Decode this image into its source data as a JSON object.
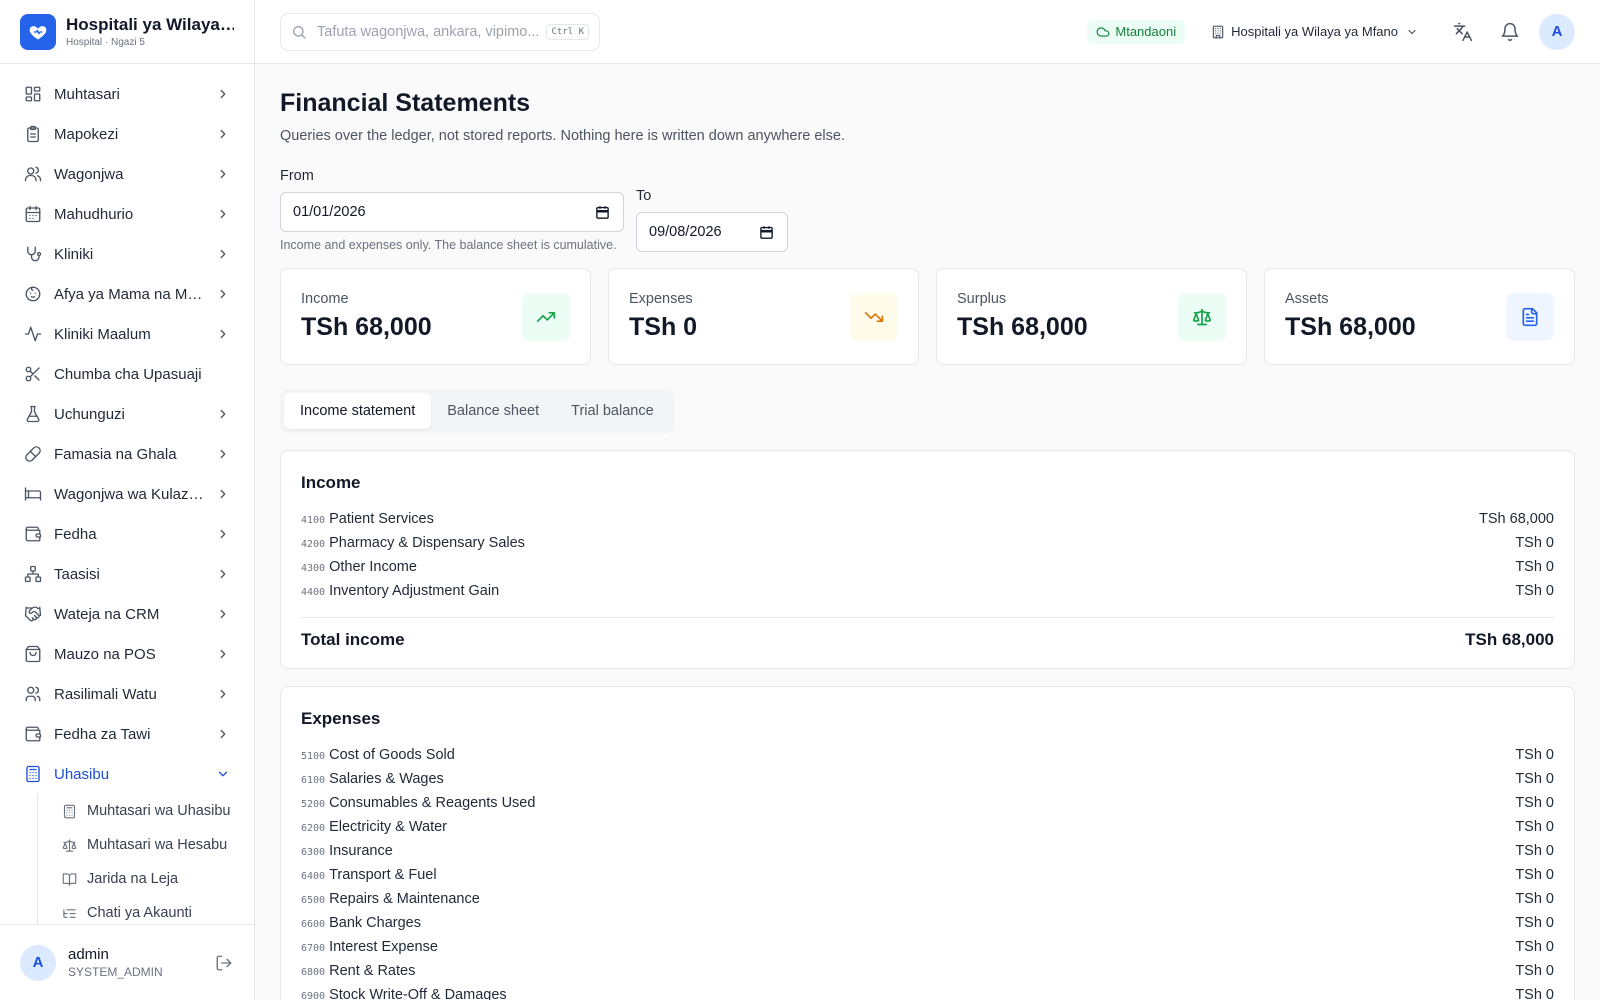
{
  "brand": {
    "name": "Hospitali ya Wilaya ...",
    "subtitle": "Hospital · Ngazi 5"
  },
  "search": {
    "placeholder": "Tafuta wagonjwa, ankara, vipimo...",
    "shortcut": "Ctrl K"
  },
  "topbar": {
    "status": "Mtandaoni",
    "branch": "Hospitali ya Wilaya ya Mfano",
    "avatar": "A"
  },
  "sidebar": {
    "items": [
      {
        "label": "Muhtasari",
        "icon": "dashboard-icon",
        "chevron": "right"
      },
      {
        "label": "Mapokezi",
        "icon": "clipboard-icon",
        "chevron": "right"
      },
      {
        "label": "Wagonjwa",
        "icon": "users-icon",
        "chevron": "right"
      },
      {
        "label": "Mahudhurio",
        "icon": "calendar-icon",
        "chevron": "right"
      },
      {
        "label": "Kliniki",
        "icon": "stethoscope-icon",
        "chevron": "right"
      },
      {
        "label": "Afya ya Mama na Mtoto",
        "icon": "baby-icon",
        "chevron": "right"
      },
      {
        "label": "Kliniki Maalum",
        "icon": "activity-icon",
        "chevron": "right"
      },
      {
        "label": "Chumba cha Upasuaji",
        "icon": "scissors-icon",
        "chevron": "none"
      },
      {
        "label": "Uchunguzi",
        "icon": "flask-icon",
        "chevron": "right"
      },
      {
        "label": "Famasia na Ghala",
        "icon": "pill-icon",
        "chevron": "right"
      },
      {
        "label": "Wagonjwa wa Kulazwa",
        "icon": "bed-icon",
        "chevron": "right"
      },
      {
        "label": "Fedha",
        "icon": "wallet-icon",
        "chevron": "right"
      },
      {
        "label": "Taasisi",
        "icon": "network-icon",
        "chevron": "right"
      },
      {
        "label": "Wateja na CRM",
        "icon": "handshake-icon",
        "chevron": "right"
      },
      {
        "label": "Mauzo na POS",
        "icon": "shopping-bag-icon",
        "chevron": "right"
      },
      {
        "label": "Rasilimali Watu",
        "icon": "user-group-icon",
        "chevron": "right"
      },
      {
        "label": "Fedha za Tawi",
        "icon": "wallet-icon",
        "chevron": "right"
      },
      {
        "label": "Uhasibu",
        "icon": "calculator-icon",
        "chevron": "down"
      }
    ],
    "sub_items": [
      {
        "label": "Muhtasari wa Uhasibu",
        "icon": "calculator-icon"
      },
      {
        "label": "Muhtasari wa Hesabu",
        "icon": "scale-icon"
      },
      {
        "label": "Jarida na Leja",
        "icon": "book-icon"
      },
      {
        "label": "Chati ya Akaunti",
        "icon": "list-tree-icon"
      }
    ],
    "user": {
      "initial": "A",
      "name": "admin",
      "role": "SYSTEM_ADMIN"
    }
  },
  "page": {
    "title": "Financial Statements",
    "description": "Queries over the ledger, not stored reports. Nothing here is written down anywhere else.",
    "from_label": "From",
    "from_value": "01/01/2026",
    "hint": "Income and expenses only. The balance sheet is cumulative.",
    "to_label": "To",
    "to_value": "09/08/2026"
  },
  "stats": [
    {
      "label": "Income",
      "value": "TSh 68,000",
      "icon": "trending-up-icon",
      "color": "#16a34a",
      "bg": "#ecfdf5"
    },
    {
      "label": "Expenses",
      "value": "TSh 0",
      "icon": "trending-down-icon",
      "color": "#d97706",
      "bg": "#fffbeb"
    },
    {
      "label": "Surplus",
      "value": "TSh 68,000",
      "icon": "scale-icon",
      "color": "#16a34a",
      "bg": "#ecfdf5"
    },
    {
      "label": "Assets",
      "value": "TSh 68,000",
      "icon": "file-icon",
      "color": "#2563eb",
      "bg": "#eff6ff"
    }
  ],
  "tabs": [
    {
      "label": "Income statement",
      "active": true
    },
    {
      "label": "Balance sheet",
      "active": false
    },
    {
      "label": "Trial balance",
      "active": false
    }
  ],
  "income": {
    "title": "Income",
    "rows": [
      {
        "code": "4100",
        "name": "Patient Services",
        "amount": "TSh 68,000"
      },
      {
        "code": "4200",
        "name": "Pharmacy & Dispensary Sales",
        "amount": "TSh 0"
      },
      {
        "code": "4300",
        "name": "Other Income",
        "amount": "TSh 0"
      },
      {
        "code": "4400",
        "name": "Inventory Adjustment Gain",
        "amount": "TSh 0"
      }
    ],
    "total_label": "Total income",
    "total_value": "TSh 68,000"
  },
  "expenses": {
    "title": "Expenses",
    "rows": [
      {
        "code": "5100",
        "name": "Cost of Goods Sold",
        "amount": "TSh 0"
      },
      {
        "code": "6100",
        "name": "Salaries & Wages",
        "amount": "TSh 0"
      },
      {
        "code": "5200",
        "name": "Consumables & Reagents Used",
        "amount": "TSh 0"
      },
      {
        "code": "6200",
        "name": "Electricity & Water",
        "amount": "TSh 0"
      },
      {
        "code": "6300",
        "name": "Insurance",
        "amount": "TSh 0"
      },
      {
        "code": "6400",
        "name": "Transport & Fuel",
        "amount": "TSh 0"
      },
      {
        "code": "6500",
        "name": "Repairs & Maintenance",
        "amount": "TSh 0"
      },
      {
        "code": "6600",
        "name": "Bank Charges",
        "amount": "TSh 0"
      },
      {
        "code": "6700",
        "name": "Interest Expense",
        "amount": "TSh 0"
      },
      {
        "code": "6800",
        "name": "Rent & Rates",
        "amount": "TSh 0"
      },
      {
        "code": "6900",
        "name": "Stock Write-Off & Damages",
        "amount": "TSh 0"
      }
    ]
  }
}
